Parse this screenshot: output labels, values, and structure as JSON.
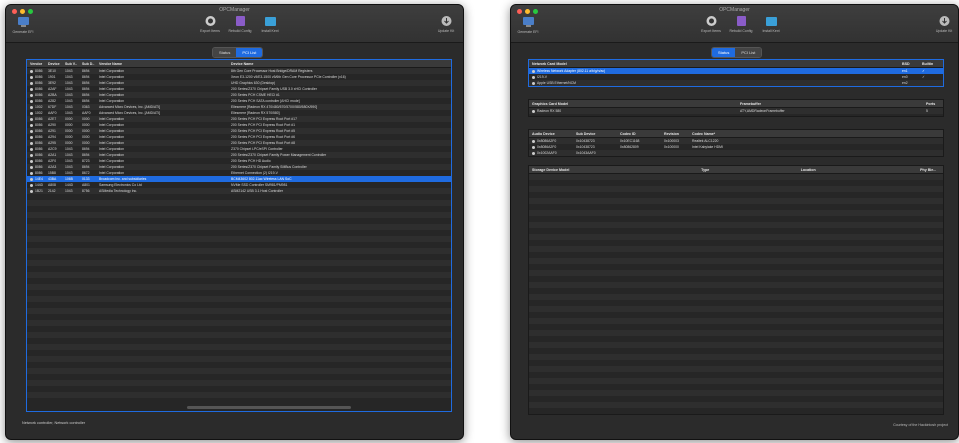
{
  "window1": {
    "title": "OPCManager",
    "toolbar": {
      "left_label": "Generate EFI",
      "btn1": "Export Items",
      "btn2": "Rebuild Config",
      "btn3": "Install Kext",
      "right_label": "Update Kit"
    },
    "tabs": [
      "Status",
      "PCI List"
    ],
    "active_tab": 1,
    "columns": [
      "Vendor",
      "Device",
      "Sub V..",
      "Sub D..",
      "Vendor Name",
      "Device Name"
    ],
    "rows": [
      [
        "8086",
        "3E10",
        "1043",
        "8694",
        "Intel Corporation",
        "8th Gen Core Processor Host Bridge/DRAM Registers"
      ],
      [
        "8086",
        "1901",
        "1043",
        "8694",
        "Intel Corporation",
        "Xeon E3-1200 v5/E3-1500 v5/6th Gen Core Processor PCIe Controller (x16)"
      ],
      [
        "8086",
        "3E92",
        "1043",
        "8694",
        "Intel Corporation",
        "UHD Graphics 630 (Desktop)"
      ],
      [
        "8086",
        "A2AF",
        "1043",
        "8694",
        "Intel Corporation",
        "200 Series/Z370 Chipset Family USB 3.0 xHCI Controller"
      ],
      [
        "8086",
        "A2BA",
        "1043",
        "8694",
        "Intel Corporation",
        "200 Series PCH CSME HECI #1"
      ],
      [
        "8086",
        "A282",
        "1043",
        "8694",
        "Intel Corporation",
        "200 Series PCH SATA controller [AHCI mode]"
      ],
      [
        "1002",
        "67DF",
        "1043",
        "0363",
        "Advanced Micro Devices, Inc. [AMD/ATI]",
        "Ellesmere [Radeon RX 470/480/570/570X/580/580X/590]"
      ],
      [
        "1002",
        "AAF0",
        "1043",
        "AAF0",
        "Advanced Micro Devices, Inc. [AMD/ATI]",
        "Ellesmere [Radeon RX 570/580]"
      ],
      [
        "8086",
        "A2E7",
        "0000",
        "0000",
        "Intel Corporation",
        "200 Series PCH PCI Express Root Port #17"
      ],
      [
        "8086",
        "A290",
        "0000",
        "0000",
        "Intel Corporation",
        "200 Series PCH PCI Express Root Port #1"
      ],
      [
        "8086",
        "A291",
        "0000",
        "0000",
        "Intel Corporation",
        "200 Series PCH PCI Express Root Port #5"
      ],
      [
        "8086",
        "A294",
        "0000",
        "0000",
        "Intel Corporation",
        "200 Series PCH PCI Express Root Port #6"
      ],
      [
        "8086",
        "A295",
        "0000",
        "0000",
        "Intel Corporation",
        "200 Series PCH PCI Express Root Port #8"
      ],
      [
        "8086",
        "A2C9",
        "1043",
        "8694",
        "Intel Corporation",
        "Z370 Chipset LPC/eSPI Controller"
      ],
      [
        "8086",
        "A2A1",
        "1043",
        "8694",
        "Intel Corporation",
        "200 Series/Z370 Chipset Family Power Management Controller"
      ],
      [
        "8086",
        "A2F0",
        "1043",
        "8723",
        "Intel Corporation",
        "200 Series PCH HD Audio"
      ],
      [
        "8086",
        "A2A3",
        "1043",
        "8694",
        "Intel Corporation",
        "200 Series/Z370 Chipset Family SMBus Controller"
      ],
      [
        "8086",
        "15B8",
        "1043",
        "8672",
        "Intel Corporation",
        "Ethernet Connection (2) I219-V"
      ],
      [
        "14E4",
        "43BA",
        "106B",
        "0133",
        "Broadcom Inc. and subsidiaries",
        "BCM43602 802.11ac Wireless LAN SoC"
      ],
      [
        "144D",
        "A808",
        "144D",
        "A801",
        "Samsung Electronics Co Ltd",
        "NVMe SSD Controller SM981/PM981"
      ],
      [
        "1B21",
        "2142",
        "1043",
        "8756",
        "ASMedia Technology Inc.",
        "ASM2142 USB 3.1 Host Controller"
      ]
    ],
    "selected_row": 18,
    "status_text": "Network controller, Network controller"
  },
  "window2": {
    "title": "OPCManager",
    "toolbar": {
      "left_label": "Generate EFI",
      "btn1": "Export Items",
      "btn2": "Rebuild Config",
      "btn3": "Install Kext",
      "right_label": "Update Kit"
    },
    "tabs": [
      "Status",
      "PCI List"
    ],
    "active_tab": 0,
    "net": {
      "columns": [
        "Network Card Model",
        "",
        "BSD",
        "Builtin"
      ],
      "rows": [
        [
          "Wireless Network Adapter (802.11 a/b/g/n/ac)",
          "",
          "en1",
          "✓"
        ],
        [
          "I219-V",
          "",
          "en0",
          "✓"
        ],
        [
          "Apple USB Ethernet/NCM",
          "",
          "en2",
          ""
        ]
      ],
      "selected_row": 0
    },
    "gpu": {
      "columns": [
        "Graphics Card Model",
        "Framebuffer",
        "Ports"
      ],
      "rows": [
        [
          "Radeon RX 580",
          "ATY,AMDRadeonFramebuffer",
          "5"
        ]
      ]
    },
    "audio": {
      "columns": [
        "Audio Device",
        "Sub Device",
        "Codec ID",
        "Revision",
        "Codec Name*"
      ],
      "rows": [
        [
          "0x8086A2F0",
          "0x10438723",
          "0x10EC1168",
          "0x100003",
          "Realtek ALC1220"
        ],
        [
          "0x8086A2F0",
          "0x10438723",
          "0x80862809",
          "0x100000",
          "Intel Kabylake HDMI"
        ],
        [
          "0x1002AAF0",
          "0x1043AAF0",
          "",
          "",
          ""
        ]
      ]
    },
    "storage": {
      "columns": [
        "Storage Device Model",
        "Type",
        "Location",
        "Phy Ble..."
      ]
    },
    "footer": "Courtesy of the Hackintosh project"
  }
}
